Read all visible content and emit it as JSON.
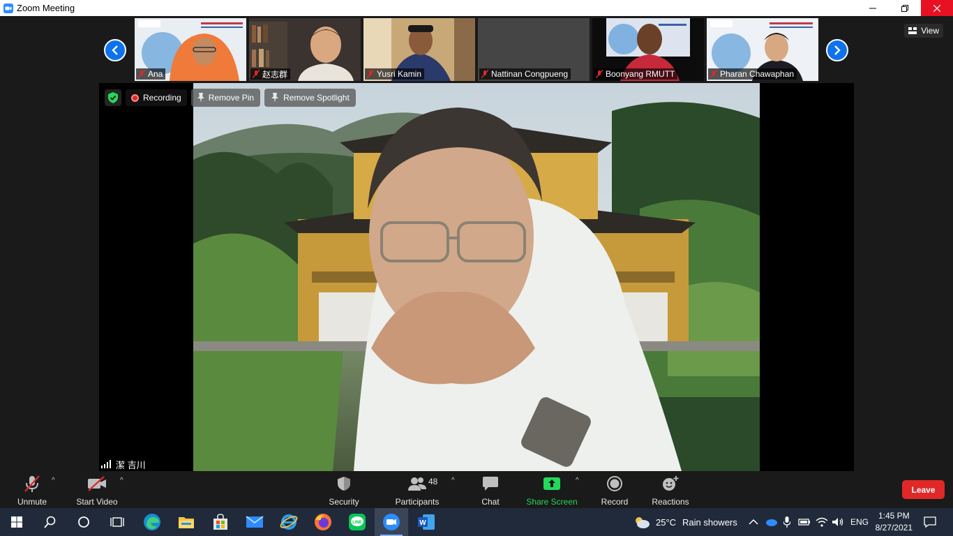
{
  "window": {
    "title": "Zoom Meeting"
  },
  "top_bar": {
    "view_label": "View"
  },
  "participants_strip": [
    {
      "name": "Ana",
      "muted": true
    },
    {
      "name": "赵志群",
      "muted": true
    },
    {
      "name": "Yusri Kamin",
      "muted": true
    },
    {
      "name": "Nattinan Congpueng",
      "muted": true
    },
    {
      "name": "Boonyang RMUTT",
      "muted": true
    },
    {
      "name": "Pharan Chawaphan",
      "muted": true
    }
  ],
  "main_video": {
    "recording_label": "Recording",
    "remove_pin_label": "Remove Pin",
    "remove_spotlight_label": "Remove Spotlight",
    "speaker_name": "潔 吉川"
  },
  "toolbar": {
    "unmute_label": "Unmute",
    "start_video_label": "Start Video",
    "security_label": "Security",
    "participants_label": "Participants",
    "participants_count": "48",
    "chat_label": "Chat",
    "share_screen_label": "Share Screen",
    "record_label": "Record",
    "reactions_label": "Reactions",
    "leave_label": "Leave"
  },
  "taskbar": {
    "weather_temp": "25°C",
    "weather_desc": "Rain showers",
    "language": "ENG",
    "time": "1:45 PM",
    "date": "8/27/2021"
  },
  "colors": {
    "zoom_blue": "#0e72ed",
    "leave_red": "#e02828",
    "share_green": "#23d959",
    "close_red": "#e81123"
  }
}
